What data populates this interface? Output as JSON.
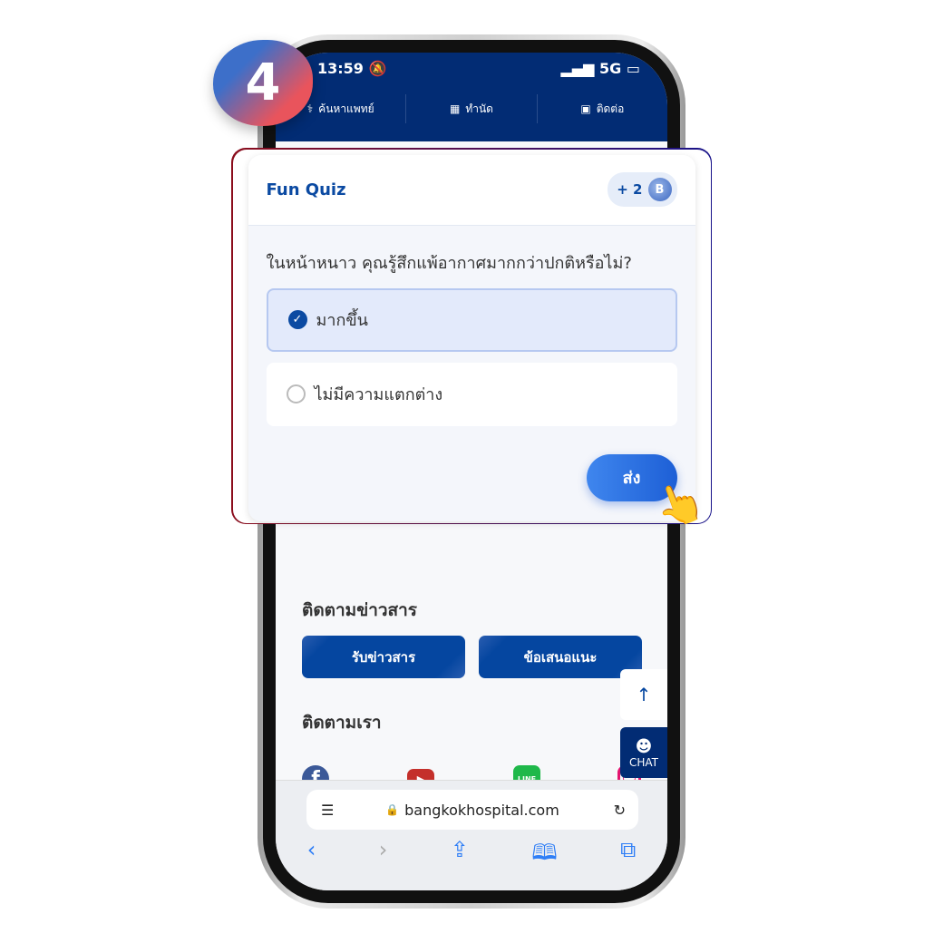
{
  "step_badge": "4",
  "status": {
    "time": "13:59",
    "network": "5G"
  },
  "nav": [
    {
      "label": "ค้นหาแพทย์",
      "icon": "stethoscope-icon"
    },
    {
      "label": "ทำนัด",
      "icon": "calendar-icon"
    },
    {
      "label": "ติดต่อ",
      "icon": "chat-icon"
    }
  ],
  "quiz": {
    "title": "Fun Quiz",
    "points": "+ 2",
    "coin": "B",
    "question": "ในหน้าหนาว คุณรู้สึกแพ้อากาศมากกว่าปกติหรือไม่?",
    "options": [
      {
        "label": "มากขึ้น",
        "selected": true
      },
      {
        "label": "ไม่มีความแตกต่าง",
        "selected": false
      }
    ],
    "submit": "ส่ง"
  },
  "news": {
    "title": "ติดตามข่าวสาร",
    "subscribe": "รับข่าวสาร",
    "suggest": "ข้อเสนอแนะ"
  },
  "follow": {
    "title": "ติดตามเรา",
    "line": "LINE"
  },
  "chat": "CHAT",
  "browser": {
    "url": "bangkokhospital.com"
  },
  "colors": {
    "primary": "#022c74",
    "accent": "#0b4aa2",
    "button": "#0546a0"
  }
}
